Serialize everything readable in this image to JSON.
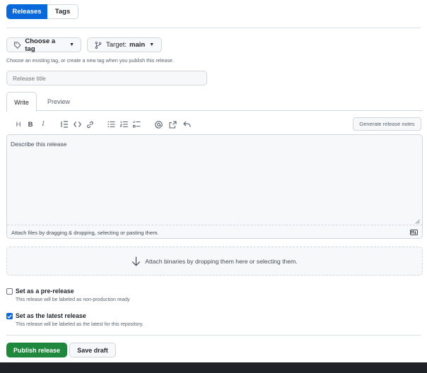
{
  "segmented": {
    "releases": "Releases",
    "tags": "Tags"
  },
  "tag_picker": {
    "label": "Choose a tag",
    "icon": "tag-icon"
  },
  "target_picker": {
    "prefix": "Target:",
    "branch": "main",
    "icon": "git-branch-icon"
  },
  "tag_hint": "Choose an existing tag, or create a new tag when you publish this release.",
  "release_title": {
    "placeholder": "Release title",
    "value": ""
  },
  "editor_tabs": {
    "write": "Write",
    "preview": "Preview"
  },
  "toolbar": {
    "icons": [
      "heading-icon",
      "bold-icon",
      "italic-icon",
      "quote-icon",
      "code-icon",
      "link-icon",
      "unordered-list-icon",
      "ordered-list-icon",
      "task-list-icon",
      "mention-icon",
      "cross-reference-icon",
      "reply-icon"
    ],
    "generate_notes": "Generate release notes"
  },
  "editor": {
    "placeholder": "Describe this release",
    "attach_hint": "Attach files by dragging & dropping, selecting or pasting them."
  },
  "binaries_drop": "Attach binaries by dropping them here or selecting them.",
  "prerelease": {
    "title": "Set as a pre-release",
    "desc": "This release will be labeled as non-production ready",
    "checked": false
  },
  "latest": {
    "title": "Set as the latest release",
    "desc": "This release will be labeled as the latest for this repository.",
    "checked": true
  },
  "actions": {
    "publish": "Publish release",
    "save_draft": "Save draft"
  },
  "colors": {
    "accent": "#0969da",
    "publish": "#1f883d",
    "bottom_bar": "#1f2328"
  }
}
